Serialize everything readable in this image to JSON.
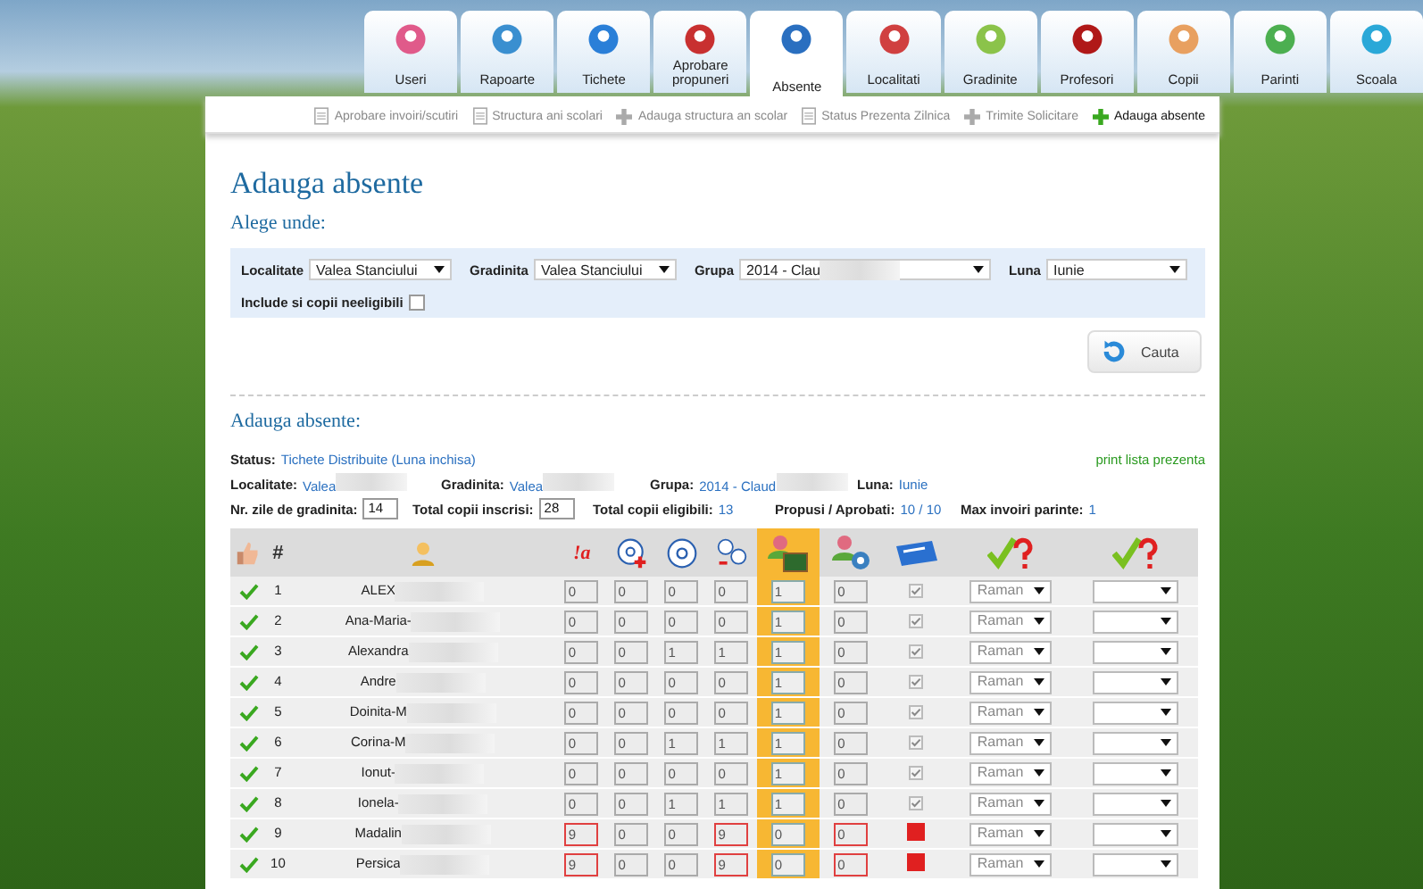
{
  "tabs": [
    {
      "label": "Useri",
      "selected": false
    },
    {
      "label": "Rapoarte",
      "selected": false
    },
    {
      "label": "Tichete",
      "selected": false
    },
    {
      "label": "Aprobare propuneri",
      "selected": false
    },
    {
      "label": "Absente",
      "selected": true
    },
    {
      "label": "Localitati",
      "selected": false
    },
    {
      "label": "Gradinite",
      "selected": false
    },
    {
      "label": "Profesori",
      "selected": false
    },
    {
      "label": "Copii",
      "selected": false
    },
    {
      "label": "Parinti",
      "selected": false
    },
    {
      "label": "Scoala",
      "selected": false
    }
  ],
  "subnav": [
    {
      "label": "Aprobare invoiri/scutiri",
      "kind": "doc",
      "selected": false
    },
    {
      "label": "Structura ani scolari",
      "kind": "doc",
      "selected": false
    },
    {
      "label": "Adauga structura an scolar",
      "kind": "add",
      "selected": false
    },
    {
      "label": "Status Prezenta Zilnica",
      "kind": "doc",
      "selected": false
    },
    {
      "label": "Trimite Solicitare",
      "kind": "add",
      "selected": false
    },
    {
      "label": "Adauga absente",
      "kind": "add",
      "selected": true
    }
  ],
  "page_title": "Adauga absente",
  "filter": {
    "title": "Alege unde:",
    "fields": [
      {
        "label": "Localitate",
        "value": "Valea Stanciului",
        "redacted": false
      },
      {
        "label": "Gradinita",
        "value": "Valea Stanciului",
        "redacted": false
      },
      {
        "label": "Grupa",
        "value": "2014 - Clau",
        "redacted": true
      },
      {
        "label": "Luna",
        "value": "Iunie",
        "redacted": false
      }
    ],
    "include_label": "Include si copii neeligibili",
    "include_checked": false,
    "search_button": "Cauta"
  },
  "section_title": "Adauga absente:",
  "status": {
    "label": "Status:",
    "value": "Tichete Distribuite (Luna inchisa)"
  },
  "print_link": "print lista prezenta",
  "info": [
    {
      "label": "Localitate:",
      "value": "Valea",
      "redacted": true
    },
    {
      "label": "Gradinita:",
      "value": "Valea",
      "redacted": true
    },
    {
      "label": "Grupa:",
      "value": "2014 - Claud",
      "redacted": true
    },
    {
      "label": "Luna:",
      "value": "Iunie",
      "redacted": false
    }
  ],
  "counts": [
    {
      "label": "Nr. zile de gradinita:",
      "value": "14",
      "kind": "input"
    },
    {
      "label": "Total copii inscrisi:",
      "value": "28",
      "kind": "input"
    },
    {
      "label": "Total copii eligibili:",
      "value": "13",
      "kind": "text"
    },
    {
      "label": "Propusi / Aprobati:",
      "value": "10 / 10",
      "kind": "text"
    },
    {
      "label": "Max invoiri parinte:",
      "value": "1",
      "kind": "text"
    }
  ],
  "table": {
    "hash_header": "#",
    "excl_header": "!a",
    "rows": [
      {
        "number": "1",
        "name": "ALEX",
        "ticket": true,
        "cells": [
          {
            "value": "0",
            "error": false
          },
          {
            "value": "0",
            "error": false
          },
          {
            "value": "0",
            "error": false
          },
          {
            "value": "0",
            "error": false
          },
          {
            "value": "1",
            "error": false
          },
          {
            "value": "0",
            "error": false
          }
        ],
        "decision": "Raman"
      },
      {
        "number": "2",
        "name": "Ana-Maria-",
        "ticket": true,
        "cells": [
          {
            "value": "0",
            "error": false
          },
          {
            "value": "0",
            "error": false
          },
          {
            "value": "0",
            "error": false
          },
          {
            "value": "0",
            "error": false
          },
          {
            "value": "1",
            "error": false
          },
          {
            "value": "0",
            "error": false
          }
        ],
        "decision": "Raman"
      },
      {
        "number": "3",
        "name": "Alexandra",
        "ticket": true,
        "cells": [
          {
            "value": "0",
            "error": false
          },
          {
            "value": "0",
            "error": false
          },
          {
            "value": "1",
            "error": false
          },
          {
            "value": "1",
            "error": false
          },
          {
            "value": "1",
            "error": false
          },
          {
            "value": "0",
            "error": false
          }
        ],
        "decision": "Raman"
      },
      {
        "number": "4",
        "name": "Andre",
        "ticket": true,
        "cells": [
          {
            "value": "0",
            "error": false
          },
          {
            "value": "0",
            "error": false
          },
          {
            "value": "0",
            "error": false
          },
          {
            "value": "0",
            "error": false
          },
          {
            "value": "1",
            "error": false
          },
          {
            "value": "0",
            "error": false
          }
        ],
        "decision": "Raman"
      },
      {
        "number": "5",
        "name": "Doinita-M",
        "ticket": true,
        "cells": [
          {
            "value": "0",
            "error": false
          },
          {
            "value": "0",
            "error": false
          },
          {
            "value": "0",
            "error": false
          },
          {
            "value": "0",
            "error": false
          },
          {
            "value": "1",
            "error": false
          },
          {
            "value": "0",
            "error": false
          }
        ],
        "decision": "Raman"
      },
      {
        "number": "6",
        "name": "Corina-M",
        "ticket": true,
        "cells": [
          {
            "value": "0",
            "error": false
          },
          {
            "value": "0",
            "error": false
          },
          {
            "value": "1",
            "error": false
          },
          {
            "value": "1",
            "error": false
          },
          {
            "value": "1",
            "error": false
          },
          {
            "value": "0",
            "error": false
          }
        ],
        "decision": "Raman"
      },
      {
        "number": "7",
        "name": "Ionut-",
        "ticket": true,
        "cells": [
          {
            "value": "0",
            "error": false
          },
          {
            "value": "0",
            "error": false
          },
          {
            "value": "0",
            "error": false
          },
          {
            "value": "0",
            "error": false
          },
          {
            "value": "1",
            "error": false
          },
          {
            "value": "0",
            "error": false
          }
        ],
        "decision": "Raman"
      },
      {
        "number": "8",
        "name": "Ionela-",
        "ticket": true,
        "cells": [
          {
            "value": "0",
            "error": false
          },
          {
            "value": "0",
            "error": false
          },
          {
            "value": "1",
            "error": false
          },
          {
            "value": "1",
            "error": false
          },
          {
            "value": "1",
            "error": false
          },
          {
            "value": "0",
            "error": false
          }
        ],
        "decision": "Raman"
      },
      {
        "number": "9",
        "name": "Madalin",
        "ticket": false,
        "cells": [
          {
            "value": "9",
            "error": true
          },
          {
            "value": "0",
            "error": false
          },
          {
            "value": "0",
            "error": false
          },
          {
            "value": "9",
            "error": true
          },
          {
            "value": "0",
            "error": false
          },
          {
            "value": "0",
            "error": true
          }
        ],
        "decision": "Raman"
      },
      {
        "number": "10",
        "name": "Persica",
        "ticket": false,
        "cells": [
          {
            "value": "9",
            "error": true
          },
          {
            "value": "0",
            "error": false
          },
          {
            "value": "0",
            "error": false
          },
          {
            "value": "9",
            "error": true
          },
          {
            "value": "0",
            "error": false
          },
          {
            "value": "0",
            "error": true
          }
        ],
        "decision": "Raman"
      }
    ]
  }
}
